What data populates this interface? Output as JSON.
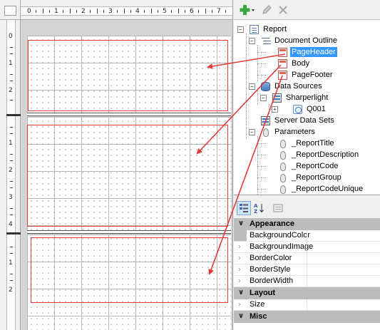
{
  "ruler": {
    "h_labels": [
      "0",
      "1",
      "2",
      "3",
      "4",
      "5",
      "6",
      "7"
    ],
    "v_labels": [
      "0",
      "1",
      "2",
      "1",
      "2",
      "3",
      "4",
      "1",
      "2"
    ]
  },
  "tree": {
    "nodes": [
      {
        "label": "Report"
      },
      {
        "label": "Document Outline"
      },
      {
        "label": "PageHeader",
        "selected": true
      },
      {
        "label": "Body"
      },
      {
        "label": "PageFooter"
      },
      {
        "label": "Data Sources"
      },
      {
        "label": "Sharperlight"
      },
      {
        "label": "Q001"
      },
      {
        "label": "Server Data Sets"
      },
      {
        "label": "Parameters"
      },
      {
        "label": "_ReportTitle"
      },
      {
        "label": "_ReportDescription"
      },
      {
        "label": "_ReportCode"
      },
      {
        "label": "_ReportGroup"
      },
      {
        "label": "_ReportCodeUnique"
      }
    ]
  },
  "toolbar": {
    "add_icon": "add-plus-icon",
    "edit_icon": "pencil-icon",
    "delete_icon": "delete-x-icon"
  },
  "properties": {
    "categories": [
      {
        "name": "Appearance",
        "items": [
          "BackgroundColor",
          "BackgroundImage",
          "BorderColor",
          "BorderStyle",
          "BorderWidth"
        ]
      },
      {
        "name": "Layout",
        "items": [
          "Size"
        ]
      },
      {
        "name": "Misc",
        "items": []
      }
    ]
  },
  "colors": {
    "annotation": "#e23a3a",
    "selection": "#3399ff",
    "category_bg": "#bcbcbc"
  }
}
